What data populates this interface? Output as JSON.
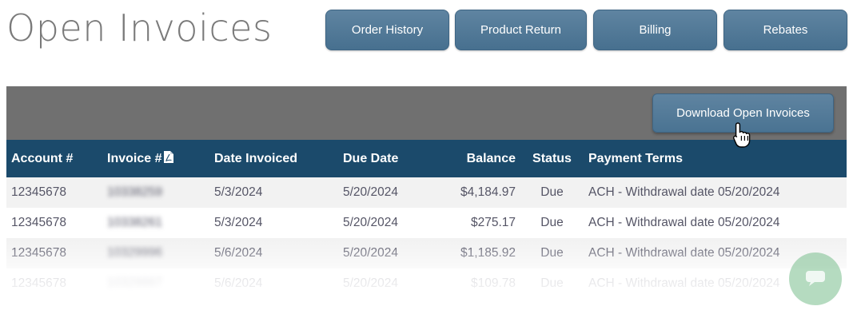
{
  "page": {
    "title": "Open Invoices"
  },
  "nav": [
    {
      "label": "Order History"
    },
    {
      "label": "Product Return"
    },
    {
      "label": "Billing"
    },
    {
      "label": "Rebates"
    }
  ],
  "toolbar": {
    "download_label": "Download Open Invoices"
  },
  "table": {
    "headers": [
      "Account #",
      "Invoice #",
      "Date Invoiced",
      "Due Date",
      "Balance",
      "Status",
      "Payment Terms"
    ],
    "rows": [
      {
        "account": "12345678",
        "invoice": "10338259",
        "date_invoiced": "5/3/2024",
        "due_date": "5/20/2024",
        "balance": "$4,184.97",
        "status": "Due",
        "terms": "ACH - Withdrawal date 05/20/2024"
      },
      {
        "account": "12345678",
        "invoice": "10338261",
        "date_invoiced": "5/3/2024",
        "due_date": "5/20/2024",
        "balance": "$275.17",
        "status": "Due",
        "terms": "ACH - Withdrawal date 05/20/2024"
      },
      {
        "account": "12345678",
        "invoice": "10329996",
        "date_invoiced": "5/6/2024",
        "due_date": "5/20/2024",
        "balance": "$1,185.92",
        "status": "Due",
        "terms": "ACH - Withdrawal date 05/20/2024"
      },
      {
        "account": "12345678",
        "invoice": "10329997",
        "date_invoiced": "5/6/2024",
        "due_date": "5/20/2024",
        "balance": "$109.78",
        "status": "Due",
        "terms": "ACH - Withdrawal date 05/20/2024"
      }
    ]
  },
  "colors": {
    "button": "#4f7796",
    "header": "#1b4a6b",
    "toolbar": "#707070"
  },
  "icons": [
    "pdf-icon",
    "pointer-cursor-icon",
    "chat-icon"
  ]
}
